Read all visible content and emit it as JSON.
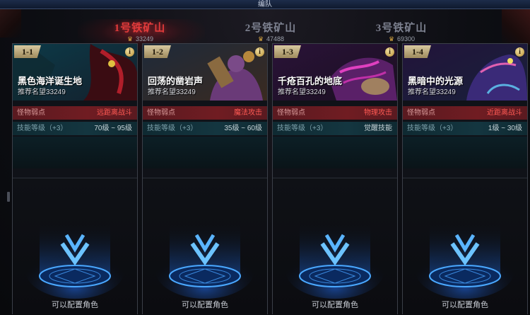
{
  "window": {
    "title": "编队"
  },
  "mines": [
    {
      "name": "1号铁矿山",
      "value": "33249",
      "active": true
    },
    {
      "name": "2号铁矿山",
      "value": "47488",
      "active": false
    },
    {
      "name": "3号铁矿山",
      "value": "69300",
      "active": false
    }
  ],
  "stages": [
    {
      "badge": "1-1",
      "name": "黑色海洋诞生地",
      "recommend": "推荐名望33249",
      "weak_label": "怪物弱点",
      "weak_value": "远距离战斗",
      "skill_label": "技能等级（+3）",
      "skill_value": "70级 ~ 95级",
      "slot_label": "可以配置角色",
      "info": "i"
    },
    {
      "badge": "1-2",
      "name": "回荡的凿岩声",
      "recommend": "推荐名望33249",
      "weak_label": "怪物弱点",
      "weak_value": "魔法攻击",
      "skill_label": "技能等级（+3）",
      "skill_value": "35级 ~ 60级",
      "slot_label": "可以配置角色",
      "info": "i"
    },
    {
      "badge": "1-3",
      "name": "千疮百孔的地底",
      "recommend": "推荐名望33249",
      "weak_label": "怪物弱点",
      "weak_value": "物理攻击",
      "skill_label": "技能等级（+3）",
      "skill_value": "觉醒技能",
      "slot_label": "可以配置角色",
      "info": "i"
    },
    {
      "badge": "1-4",
      "name": "黑暗中的光源",
      "recommend": "推荐名望33249",
      "weak_label": "怪物弱点",
      "weak_value": "近距离战斗",
      "skill_label": "技能等级（+3）",
      "skill_value": "1级 ~ 30级",
      "slot_label": "可以配置角色",
      "info": "i"
    }
  ],
  "colors": {
    "accent_red": "#e23b3b",
    "slot_blue": "#2a8cff",
    "weak_bg": "#701c22",
    "skill_bg": "#143640"
  }
}
